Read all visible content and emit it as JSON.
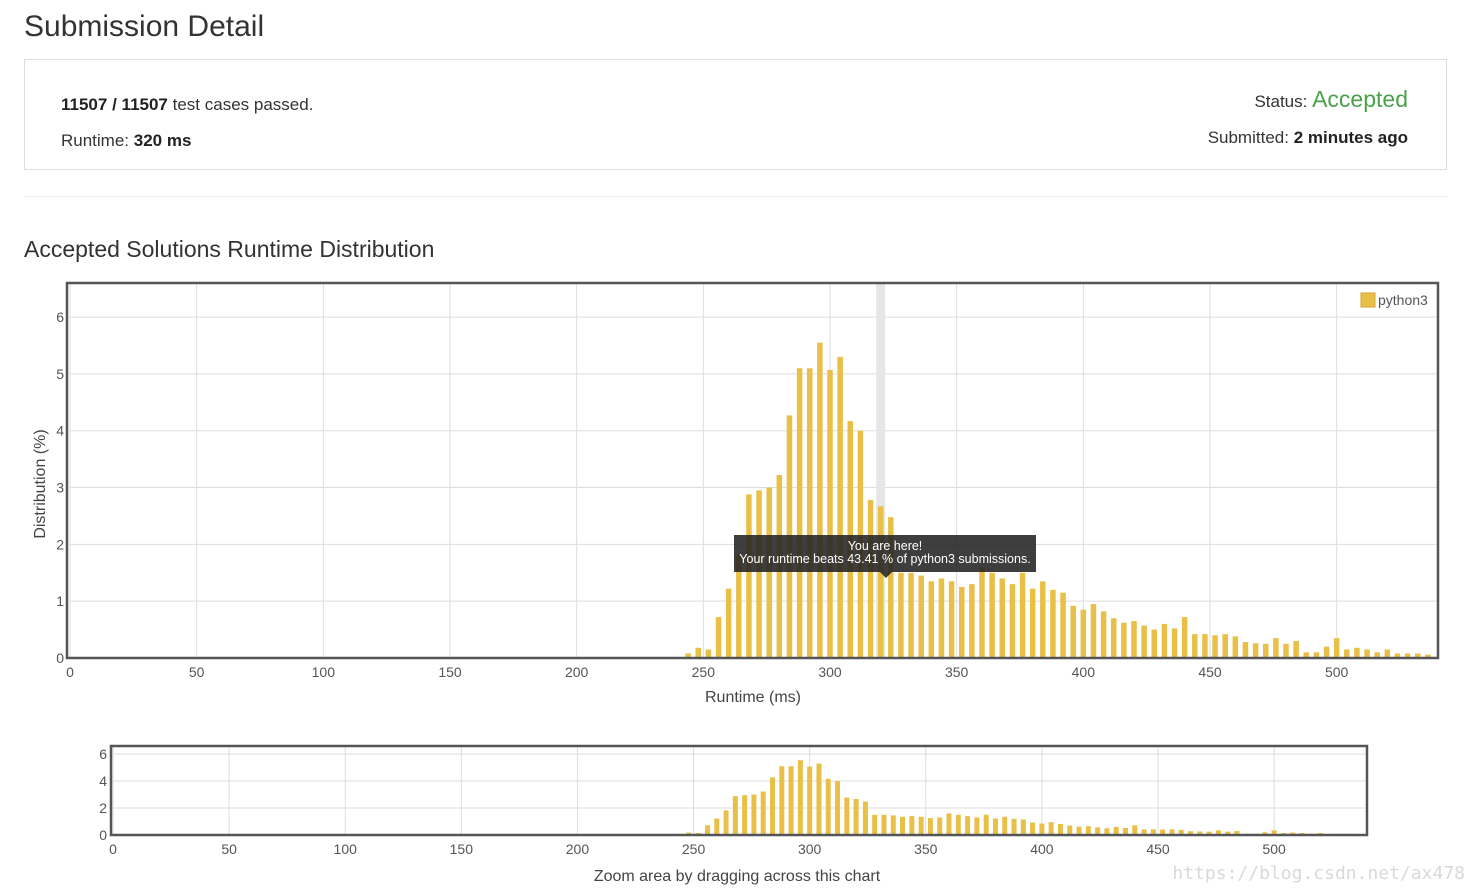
{
  "page": {
    "title": "Submission Detail"
  },
  "summary": {
    "cases_passed": "11507",
    "slash": "/",
    "cases_total": "11507",
    "cases_suffix": "test cases passed.",
    "runtime_label": "Runtime:",
    "runtime_value": "320 ms",
    "status_label": "Status:",
    "status_value": "Accepted",
    "submitted_label": "Submitted:",
    "submitted_value": "2 minutes ago"
  },
  "section": {
    "title": "Accepted Solutions Runtime Distribution"
  },
  "tooltip": {
    "line1": "You are here!",
    "line2": "Your runtime beats 43.41 % of python3 submissions."
  },
  "navigator": {
    "caption": "Zoom area by dragging across this chart"
  },
  "watermark": "https://blog.csdn.net/ax478",
  "colors": {
    "bar": "#e8c048",
    "accent": "#4aa14a",
    "highlight": "#e6e6e6"
  },
  "chart_data": {
    "type": "bar",
    "xlabel": "Runtime (ms)",
    "ylabel": "Distribution (%)",
    "xlim": [
      0,
      540
    ],
    "ylim": [
      0,
      6.6
    ],
    "x_ticks": [
      0,
      50,
      100,
      150,
      200,
      250,
      300,
      350,
      400,
      450,
      500
    ],
    "y_ticks": [
      0,
      1,
      2,
      3,
      4,
      5,
      6
    ],
    "nav_y_ticks": [
      0,
      2,
      4,
      6
    ],
    "grid": true,
    "legend": "top-right",
    "highlight_x": 320,
    "series": [
      {
        "name": "python3",
        "x": [
          244,
          248,
          252,
          256,
          260,
          264,
          268,
          272,
          276,
          280,
          284,
          288,
          292,
          296,
          300,
          304,
          308,
          312,
          316,
          320,
          324,
          328,
          332,
          336,
          340,
          344,
          348,
          352,
          356,
          360,
          364,
          368,
          372,
          376,
          380,
          384,
          388,
          392,
          396,
          400,
          404,
          408,
          412,
          416,
          420,
          424,
          428,
          432,
          436,
          440,
          444,
          448,
          452,
          456,
          460,
          464,
          468,
          472,
          476,
          480,
          484,
          488,
          492,
          496,
          500,
          504,
          508,
          512,
          516,
          520,
          524,
          528,
          532,
          536
        ],
        "values": [
          0.08,
          0.18,
          0.15,
          0.72,
          1.22,
          1.82,
          2.88,
          2.95,
          3.0,
          3.22,
          4.27,
          5.1,
          5.1,
          5.55,
          5.07,
          5.3,
          4.17,
          4.0,
          2.78,
          2.67,
          2.48,
          1.5,
          1.5,
          1.45,
          1.35,
          1.4,
          1.35,
          1.25,
          1.3,
          1.6,
          1.5,
          1.4,
          1.3,
          1.5,
          1.22,
          1.35,
          1.2,
          1.15,
          0.92,
          0.85,
          0.95,
          0.82,
          0.7,
          0.62,
          0.65,
          0.57,
          0.5,
          0.6,
          0.52,
          0.72,
          0.42,
          0.42,
          0.4,
          0.42,
          0.38,
          0.28,
          0.26,
          0.25,
          0.35,
          0.25,
          0.3,
          0.1,
          0.1,
          0.2,
          0.35,
          0.15,
          0.18,
          0.15,
          0.1,
          0.15,
          0.08,
          0.08,
          0.08,
          0.06
        ]
      }
    ]
  }
}
